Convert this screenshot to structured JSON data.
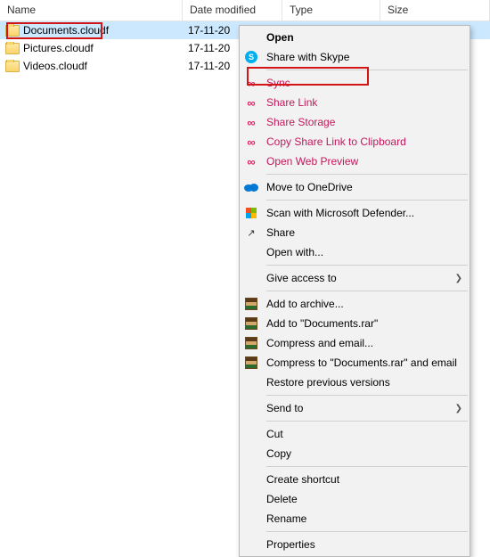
{
  "columns": {
    "name": "Name",
    "date": "Date modified",
    "type": "Type",
    "size": "Size"
  },
  "files": [
    {
      "name": "Documents.cloudf",
      "date": "17-11-20",
      "type": "",
      "size": "",
      "selected": true
    },
    {
      "name": "Pictures.cloudf",
      "date": "17-11-20",
      "type": "",
      "size": ""
    },
    {
      "name": "Videos.cloudf",
      "date": "17-11-20",
      "type": "",
      "size": ""
    }
  ],
  "menu": {
    "open": "Open",
    "skype": "Share with Skype",
    "sync": "Sync",
    "shareLink": "Share Link",
    "shareStorage": "Share Storage",
    "copyShare": "Copy Share Link to Clipboard",
    "webPreview": "Open Web Preview",
    "onedrive": "Move to OneDrive",
    "defender": "Scan with Microsoft Defender...",
    "share": "Share",
    "openWith": "Open with...",
    "giveAccess": "Give access to",
    "addArchive": "Add to archive...",
    "addRar": "Add to \"Documents.rar\"",
    "compressEmail": "Compress and email...",
    "compressRarEmail": "Compress to \"Documents.rar\" and email",
    "restore": "Restore previous versions",
    "sendTo": "Send to",
    "cut": "Cut",
    "copy": "Copy",
    "shortcut": "Create shortcut",
    "delete": "Delete",
    "rename": "Rename",
    "properties": "Properties"
  }
}
